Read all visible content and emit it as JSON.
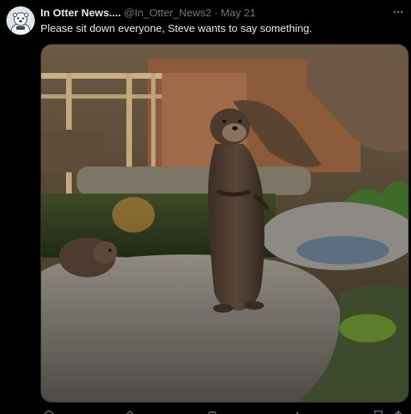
{
  "tweet": {
    "display_name": "In Otter News....",
    "handle": "@In_Otter_News2",
    "separator": "·",
    "date": "May 21",
    "text": "Please sit down everyone, Steve wants to say something."
  },
  "media": {
    "alt": "An otter standing upright on a rock while another otter lies nearby"
  },
  "actions": [
    "reply-icon",
    "repost-icon",
    "like-icon",
    "views-icon",
    "bookmark-icon",
    "share-icon"
  ],
  "colors": {
    "background": "#000000",
    "text_primary": "#e7e9ea",
    "text_secondary": "#71767b",
    "border": "#2f3336"
  }
}
